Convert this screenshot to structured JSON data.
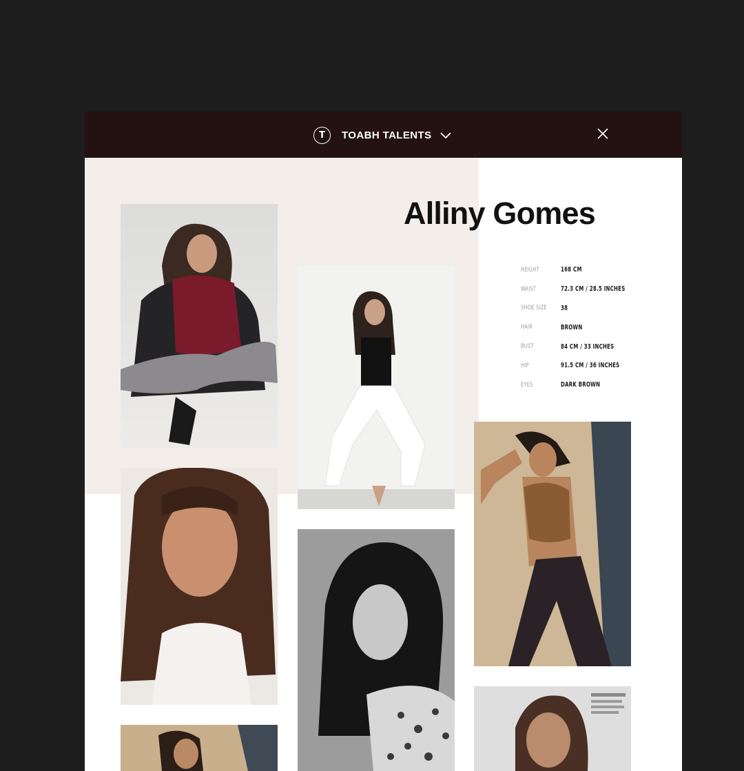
{
  "header": {
    "brand_letter": "T",
    "brand_name": "TOABH TALENTS",
    "icons": {
      "logo": "circle-t-logo-icon",
      "menu": "chevron-down-icon",
      "close": "close-icon"
    }
  },
  "profile": {
    "name": "Alliny Gomes",
    "stats": [
      {
        "label": "HEIGHT",
        "value": "168 CM"
      },
      {
        "label": "WAIST",
        "value": "72.3 CM / 28.5 INCHES"
      },
      {
        "label": "SHOE SIZE",
        "value": "38"
      },
      {
        "label": "HAIR",
        "value": "BROWN"
      },
      {
        "label": "BUST",
        "value": "84 CM / 33 INCHES"
      },
      {
        "label": "HIP",
        "value": "91.5 CM / 36 INCHES"
      },
      {
        "label": "EYES",
        "value": "DARK BROWN"
      }
    ]
  },
  "colors": {
    "page_background": "#1d1d1d",
    "header_background": "#241111",
    "beige_panel": "#f3eeea",
    "text_dark": "#111111",
    "label_grey": "#9a9a9a"
  }
}
